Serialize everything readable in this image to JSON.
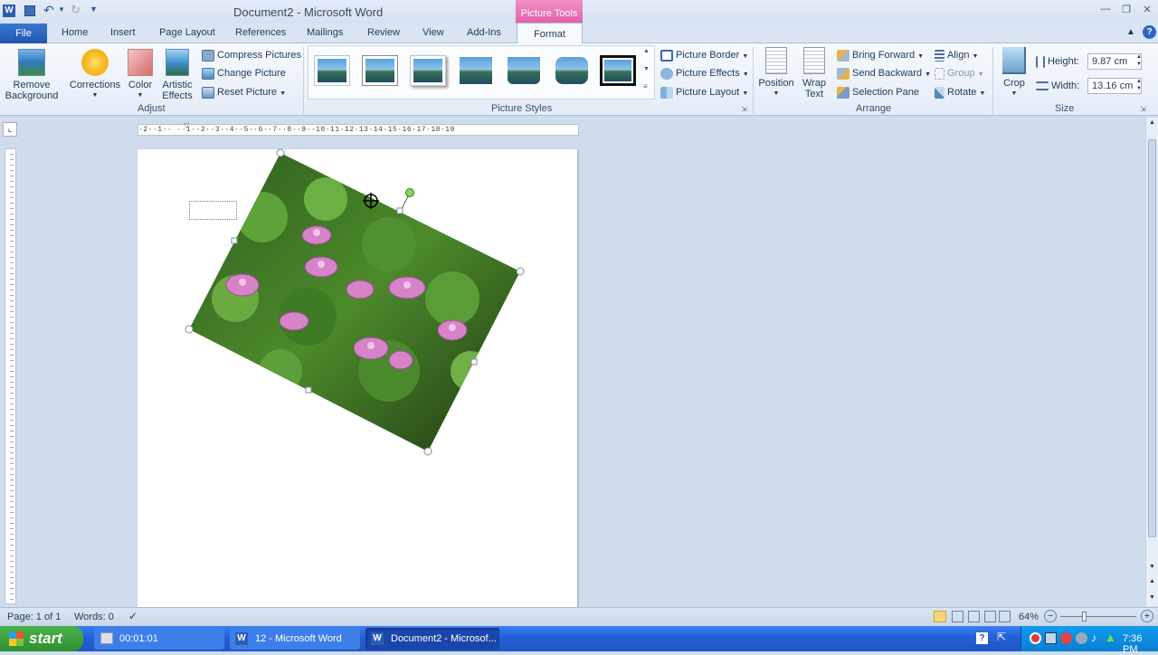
{
  "title_bar": {
    "title": "Document2  -  Microsoft Word",
    "contextual_tab": "Picture Tools",
    "window_controls": [
      "minimize-icon",
      "restore-icon",
      "close-icon"
    ]
  },
  "tabs": {
    "file": "File",
    "items": [
      "Home",
      "Insert",
      "Page Layout",
      "References",
      "Mailings",
      "Review",
      "View",
      "Add-Ins"
    ],
    "active": "Format"
  },
  "ribbon": {
    "adjust": {
      "label": "Adjust",
      "remove_background": [
        "Remove",
        "Background"
      ],
      "corrections": "Corrections",
      "color": "Color",
      "artistic_effects": [
        "Artistic",
        "Effects"
      ],
      "compress": "Compress Pictures",
      "change": "Change Picture",
      "reset": "Reset Picture"
    },
    "picture_styles": {
      "label": "Picture Styles",
      "border": "Picture Border",
      "effects": "Picture Effects",
      "layout": "Picture Layout"
    },
    "arrange": {
      "label": "Arrange",
      "position": "Position",
      "wrap_text": [
        "Wrap",
        "Text"
      ],
      "bring_forward": "Bring Forward",
      "send_backward": "Send Backward",
      "selection_pane": "Selection Pane",
      "align": "Align",
      "group": "Group",
      "rotate": "Rotate"
    },
    "size": {
      "label": "Size",
      "crop": "Crop",
      "height_label": "Height:",
      "height_value": "9.87 cm",
      "width_label": "Width:",
      "width_value": "13.16 cm"
    }
  },
  "ruler": {
    "text": "·2··1·· ··1··2··3··4··5··6··7··8··9··10·11·12·13·14·15·16·17·18·19"
  },
  "status_bar": {
    "page": "Page: 1 of 1",
    "words": "Words: 0",
    "zoom": "64%"
  },
  "taskbar": {
    "start": "start",
    "items": [
      "00:01:01",
      "12 - Microsoft Word",
      "Document2 - Microsof..."
    ],
    "clock": "7:36 PM"
  },
  "colors": {
    "file_tab": "#2b63bf",
    "contextual_tab": "#e35fa8",
    "taskbar": "#2561d8",
    "start_button": "#3a9f3a"
  }
}
